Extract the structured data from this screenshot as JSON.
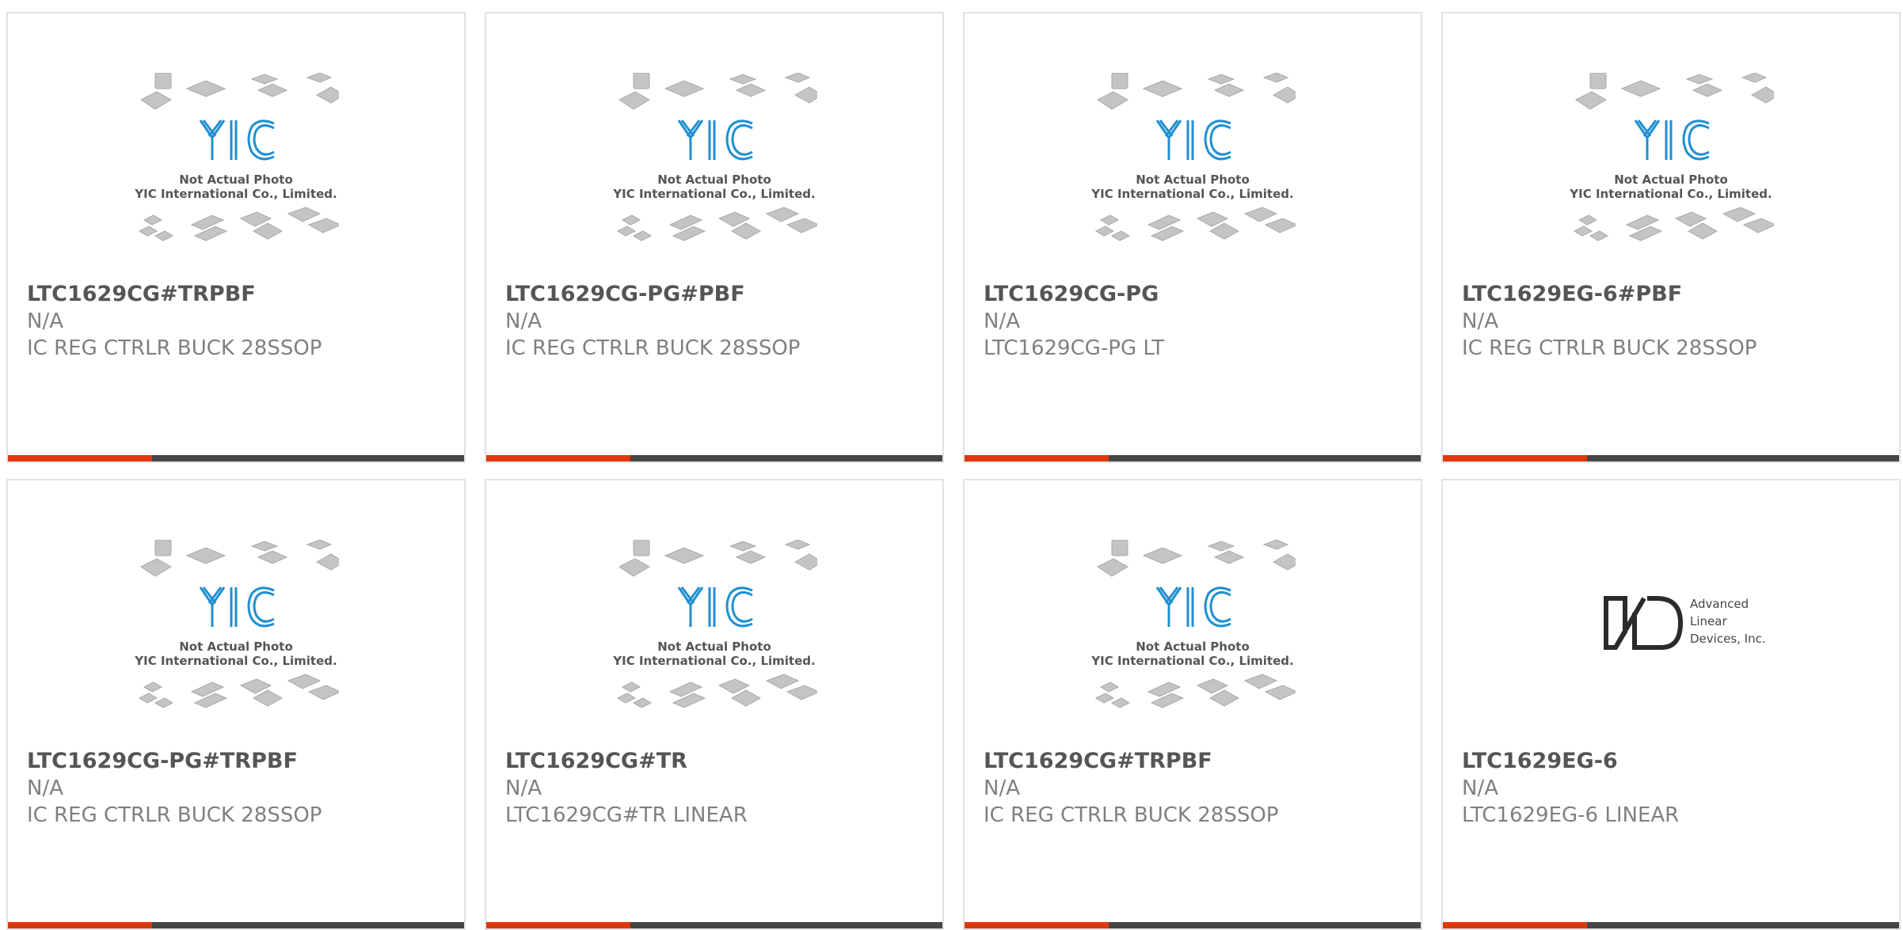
{
  "products": [
    {
      "part": "LTC1629CG#TRPBF",
      "manufacturer": "N/A",
      "description": "IC REG CTRLR BUCK 28SSOP",
      "image": "yic-placeholder",
      "image_caption": [
        "Not Actual Photo",
        "YIC International Co., Limited."
      ]
    },
    {
      "part": "LTC1629CG-PG#PBF",
      "manufacturer": "N/A",
      "description": "IC REG CTRLR BUCK 28SSOP",
      "image": "yic-placeholder",
      "image_caption": [
        "Not Actual Photo",
        "YIC International Co., Limited."
      ]
    },
    {
      "part": "LTC1629CG-PG",
      "manufacturer": "N/A",
      "description": "LTC1629CG-PG LT",
      "image": "yic-placeholder",
      "image_caption": [
        "Not Actual Photo",
        "YIC International Co., Limited."
      ]
    },
    {
      "part": "LTC1629EG-6#PBF",
      "manufacturer": "N/A",
      "description": "IC REG CTRLR BUCK 28SSOP",
      "image": "yic-placeholder",
      "image_caption": [
        "Not Actual Photo",
        "YIC International Co., Limited."
      ]
    },
    {
      "part": "LTC1629CG-PG#TRPBF",
      "manufacturer": "N/A",
      "description": "IC REG CTRLR BUCK 28SSOP",
      "image": "yic-placeholder",
      "image_caption": [
        "Not Actual Photo",
        "YIC International Co., Limited."
      ]
    },
    {
      "part": "LTC1629CG#TR",
      "manufacturer": "N/A",
      "description": "LTC1629CG#TR LINEAR",
      "image": "yic-placeholder",
      "image_caption": [
        "Not Actual Photo",
        "YIC International Co., Limited."
      ]
    },
    {
      "part": "LTC1629CG#TRPBF",
      "manufacturer": "N/A",
      "description": "IC REG CTRLR BUCK 28SSOP",
      "image": "yic-placeholder",
      "image_caption": [
        "Not Actual Photo",
        "YIC International Co., Limited."
      ]
    },
    {
      "part": "LTC1629EG-6",
      "manufacturer": "N/A",
      "description": "LTC1629EG-6 LINEAR",
      "image": "ald-logo",
      "image_caption": [
        "Advanced",
        "Linear",
        "Devices, Inc."
      ]
    }
  ],
  "colors": {
    "accent": "#e3360e",
    "bar": "#464646",
    "yic_blue": "#1f8fd0"
  }
}
